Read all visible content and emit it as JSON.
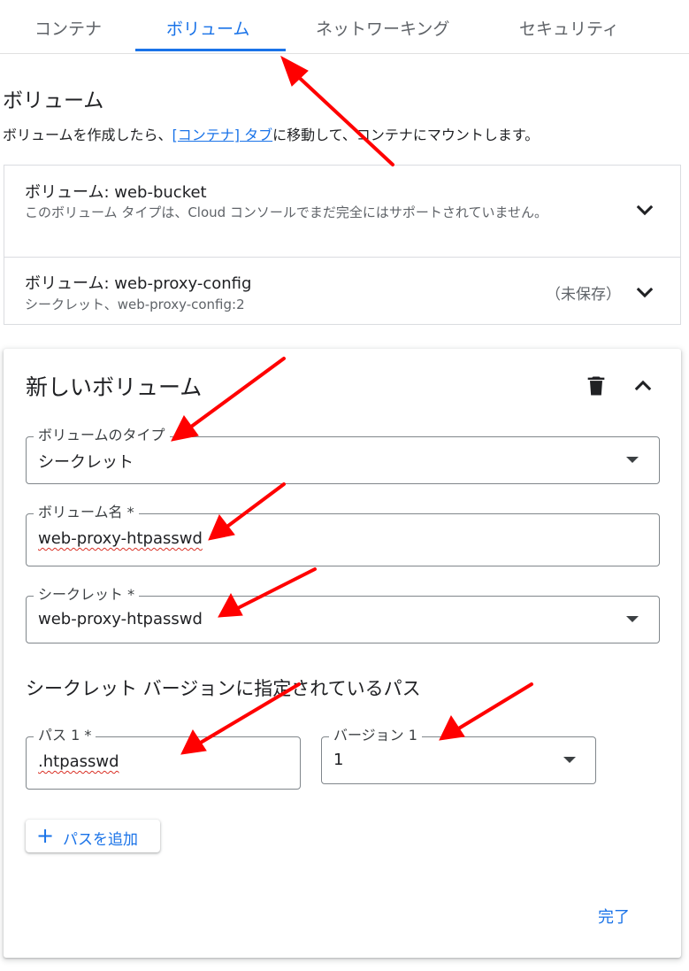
{
  "tabs": [
    {
      "label": "コンテナ",
      "active": false
    },
    {
      "label": "ボリューム",
      "active": true
    },
    {
      "label": "ネットワーキング",
      "active": false
    },
    {
      "label": "セキュリティ",
      "active": false
    }
  ],
  "volumes_section": {
    "title": "ボリューム",
    "desc_before": "ボリュームを作成したら、",
    "desc_link": "[コンテナ] タブ",
    "desc_after": "に移動して、コンテナにマウントします。"
  },
  "volumes": [
    {
      "title": "ボリューム: web-bucket",
      "subtitle": "このボリューム タイプは、Cloud コンソールでまだ完全にはサポートされていません。",
      "status": ""
    },
    {
      "title": "ボリューム: web-proxy-config",
      "subtitle": "シークレット、web-proxy-config:2",
      "status": "（未保存）"
    }
  ],
  "new_volume": {
    "title": "新しいボリューム",
    "type_label": "ボリュームのタイプ",
    "type_value": "シークレット",
    "name_label": "ボリューム名 *",
    "name_value": "web-proxy-htpasswd",
    "secret_label": "シークレット *",
    "secret_value": "web-proxy-htpasswd",
    "paths_heading": "シークレット バージョンに指定されているパス",
    "path_label": "パス 1 *",
    "path_value": ".htpasswd",
    "version_label": "バージョン 1",
    "version_value": "1",
    "add_path_label": "パスを追加",
    "done_label": "完了"
  },
  "colors": {
    "accent": "#1a73e8",
    "annotation_arrow": "#ff0000",
    "border": "#dadce0",
    "text": "#202124",
    "muted": "#5f6368"
  }
}
